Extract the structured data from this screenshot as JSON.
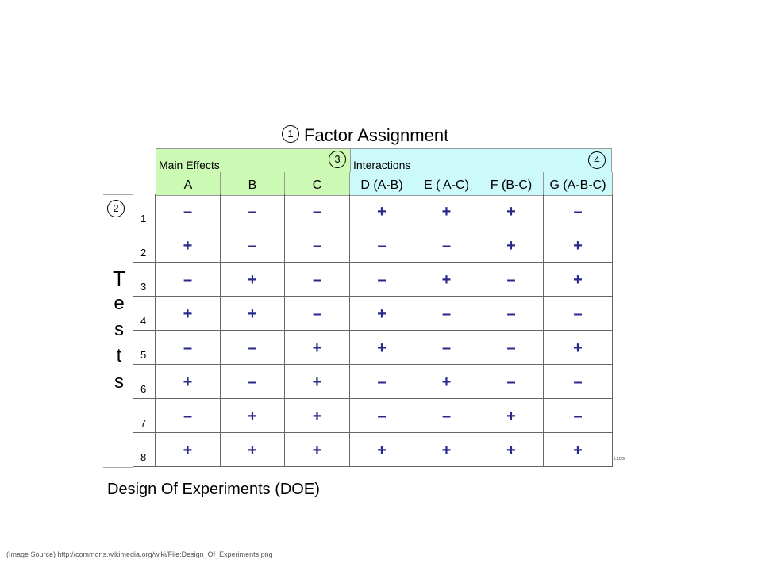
{
  "title": "Factor Assignment",
  "markers": {
    "title": "1",
    "tests": "2",
    "main_effects": "3",
    "interactions": "4"
  },
  "groups": {
    "main_effects": "Main Effects",
    "interactions": "Interactions"
  },
  "columns": [
    "A",
    "B",
    "C",
    "D (A-B)",
    "E ( A-C)",
    "F (B-C)",
    "G (A-B-C)"
  ],
  "tests_label": [
    "T",
    "e",
    "s",
    "t",
    "s"
  ],
  "rows": [
    {
      "test": "1",
      "values": [
        "–",
        "–",
        "–",
        "+",
        "+",
        "+",
        "–"
      ]
    },
    {
      "test": "2",
      "values": [
        "+",
        "–",
        "–",
        "–",
        "–",
        "+",
        "+"
      ]
    },
    {
      "test": "3",
      "values": [
        "–",
        "+",
        "–",
        "–",
        "+",
        "–",
        "+"
      ]
    },
    {
      "test": "4",
      "values": [
        "+",
        "+",
        "–",
        "+",
        "–",
        "–",
        "–"
      ]
    },
    {
      "test": "5",
      "values": [
        "–",
        "–",
        "+",
        "+",
        "–",
        "–",
        "+"
      ]
    },
    {
      "test": "6",
      "values": [
        "+",
        "–",
        "+",
        "–",
        "+",
        "–",
        "–"
      ]
    },
    {
      "test": "7",
      "values": [
        "–",
        "+",
        "+",
        "–",
        "–",
        "+",
        "–"
      ]
    },
    {
      "test": "8",
      "values": [
        "+",
        "+",
        "+",
        "+",
        "+",
        "+",
        "+"
      ]
    }
  ],
  "tiny_mark": "LLDG",
  "caption": "Design Of Experiments (DOE)",
  "source": "(Image Source) http://commons.wikimedia.org/wiki/File:Design_Of_Experiments.png"
}
